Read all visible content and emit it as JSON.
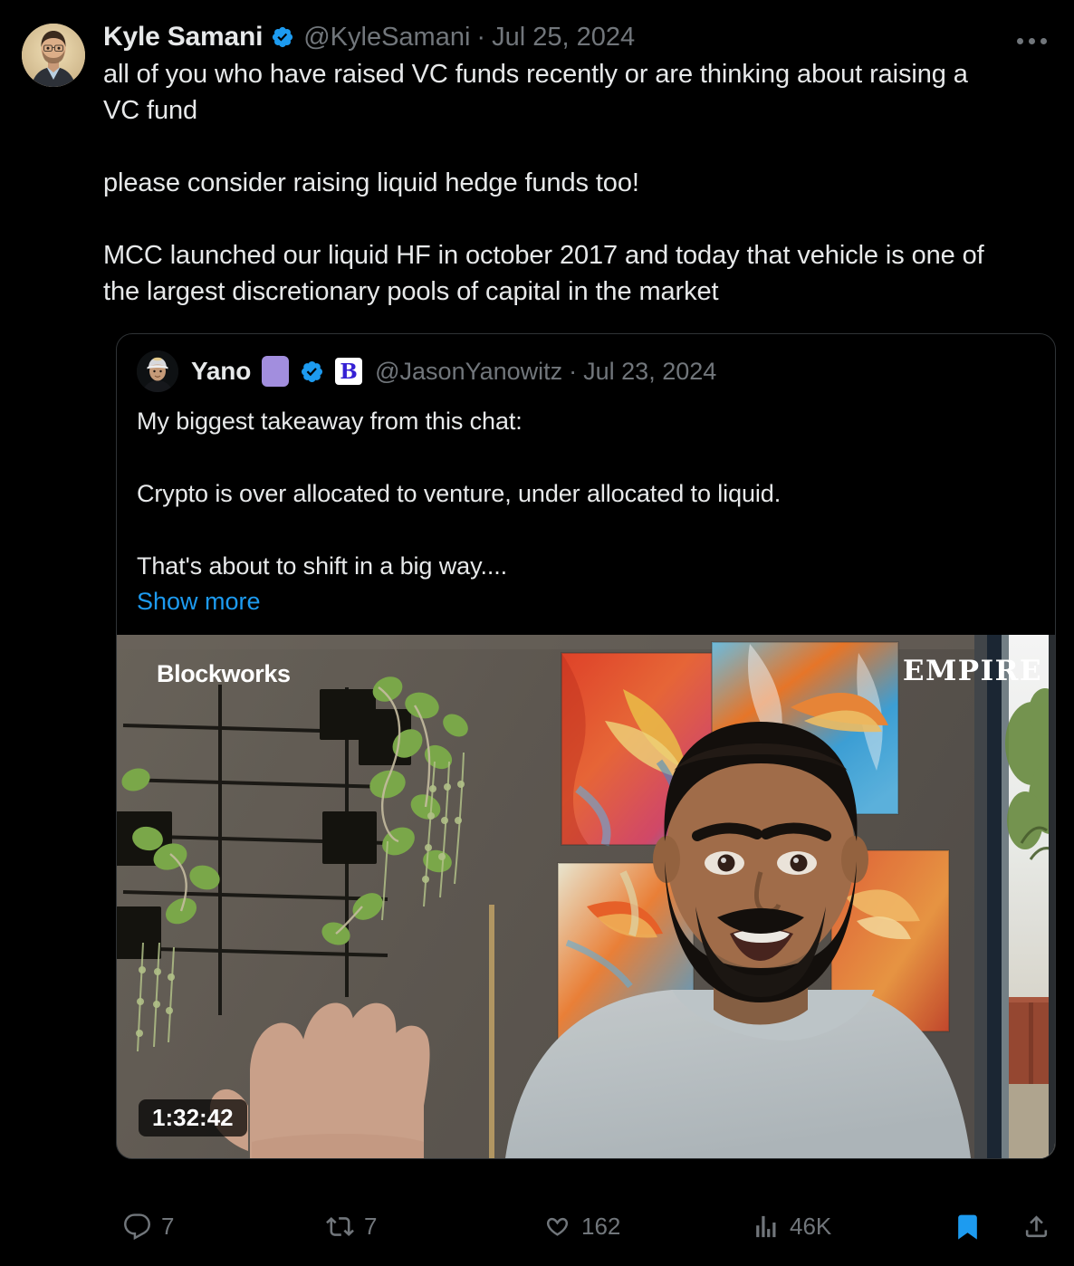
{
  "tweet": {
    "author": {
      "display_name": "Kyle Samani",
      "handle": "@KyleSamani",
      "date": "Jul 25, 2024",
      "separator": "·",
      "verified_icon": "verified-badge-icon",
      "avatar_icon": "avatar-kyle-samani"
    },
    "more_icon": "more-options-icon",
    "text": "all of you who have raised VC funds recently or are thinking about raising a VC fund\n\nplease consider raising liquid hedge funds too!\n\nMCC launched our liquid HF in october 2017 and today that vehicle is one of the largest discretionary pools of capital in the market"
  },
  "quoted_tweet": {
    "author": {
      "display_name": "Yano",
      "emoji_badge": "purple-square-emoji",
      "handle": "@JasonYanowitz",
      "date": "Jul 23, 2024",
      "separator": "·",
      "verified_icon": "verified-badge-icon",
      "affiliate_badge_letter": "B",
      "affiliate_badge_name": "blockworks-affiliate-badge",
      "avatar_icon": "avatar-jason-yanowitz"
    },
    "text": "My biggest takeaway from this chat:\n\nCrypto is over allocated to venture, under allocated to liquid.\n\nThat's about to shift in a big way....",
    "show_more_label": "Show more",
    "media": {
      "brand_logo": "Blockworks",
      "show_logo": "EMPIRE",
      "duration": "1:32:42",
      "alt_description": "Man with beard in light gray t-shirt speaking on video podcast, colorful phoenix paintings and hanging plants on gray wall behind him"
    }
  },
  "actions": {
    "reply": {
      "icon": "reply-icon",
      "count": "7"
    },
    "repost": {
      "icon": "repost-icon",
      "count": "7"
    },
    "like": {
      "icon": "heart-icon",
      "count": "162"
    },
    "views": {
      "icon": "views-icon",
      "count": "46K"
    },
    "bookmark": {
      "icon": "bookmark-filled-icon",
      "count": ""
    },
    "share": {
      "icon": "share-icon",
      "count": ""
    }
  },
  "colors": {
    "background": "#000000",
    "text_primary": "#e7e9ea",
    "text_secondary": "#71767b",
    "accent_blue": "#1d9bf0",
    "border": "#2f3336",
    "emoji_purple": "#a28ede"
  }
}
